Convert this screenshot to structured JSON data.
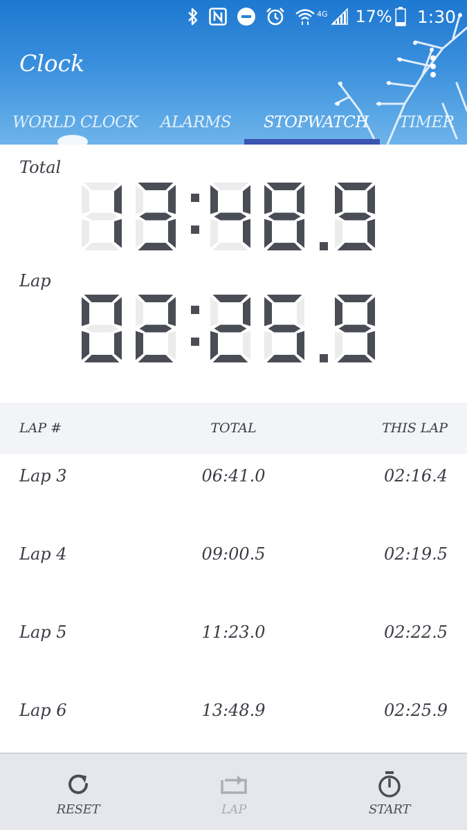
{
  "status_bar": {
    "icons": [
      "bluetooth-icon",
      "nfc-icon",
      "do-not-disturb-icon",
      "alarm-icon",
      "wifi-icon",
      "signal-icon",
      "battery-icon"
    ],
    "network_label": "4G",
    "battery_percent": "17%",
    "time": "1:30"
  },
  "app": {
    "title": "Clock",
    "menu_icon": "more-vert-icon"
  },
  "tabs": [
    {
      "label": "WORLD CLOCK",
      "active": false
    },
    {
      "label": "ALARMS",
      "active": false
    },
    {
      "label": "STOPWATCH",
      "active": true
    },
    {
      "label": "TIMER",
      "active": false
    }
  ],
  "stopwatch": {
    "total_label": "Total",
    "total_value": "13:48.9",
    "lap_label": "Lap",
    "lap_value": "02:25.9"
  },
  "laps_table": {
    "headers": {
      "lap": "LAP #",
      "total": "TOTAL",
      "this_lap": "THIS LAP"
    },
    "rows": [
      {
        "lap": "Lap 3",
        "total": "06:41.0",
        "this_lap": "02:16.4"
      },
      {
        "lap": "Lap 4",
        "total": "09:00.5",
        "this_lap": "02:19.5"
      },
      {
        "lap": "Lap 5",
        "total": "11:23.0",
        "this_lap": "02:22.5"
      },
      {
        "lap": "Lap 6",
        "total": "13:48.9",
        "this_lap": "02:25.9"
      }
    ]
  },
  "bottom_bar": {
    "reset": {
      "label": "RESET",
      "icon": "refresh-icon",
      "enabled": true
    },
    "lap": {
      "label": "LAP",
      "icon": "lap-icon",
      "enabled": false
    },
    "start": {
      "label": "START",
      "icon": "stopwatch-icon",
      "enabled": true
    }
  },
  "colors": {
    "header_blue": "#2a84d6",
    "tab_indicator": "#3b55b0",
    "digit_on": "#4a4d55",
    "digit_off": "#ececec",
    "text": "#3a3d44"
  }
}
